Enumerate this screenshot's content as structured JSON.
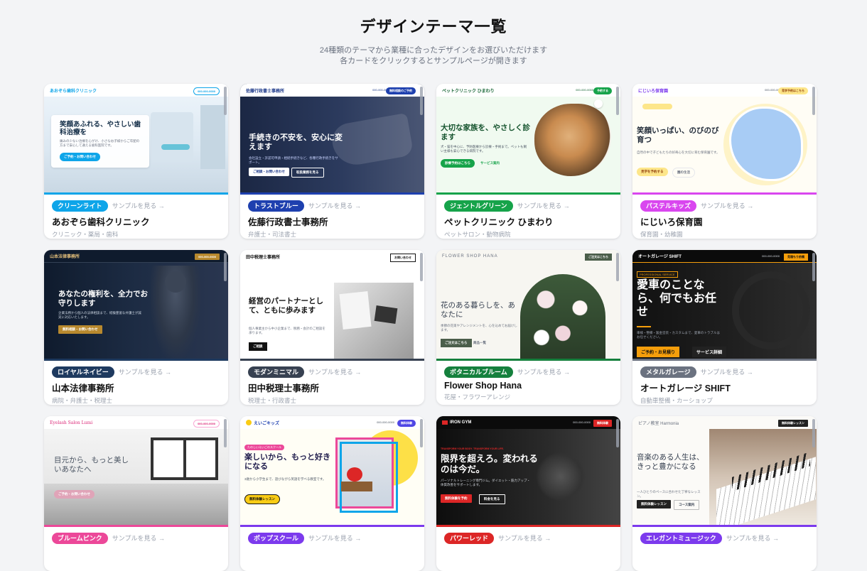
{
  "header": {
    "title": "デザインテーマ一覧",
    "subtitle1": "24種類のテーマから業種に合ったデザインをお選びいただけます",
    "subtitle2": "各カードをクリックするとサンプルページが開きます"
  },
  "sample_link": "サンプルを見る →",
  "cards": [
    {
      "badge": "クリーンライト",
      "color": "#0ea5e9",
      "name": "あおぞら歯科クリニック",
      "category": "クリニック・薬局・歯科",
      "nav": "あおぞら歯科クリニック",
      "nav_btn": "000-000-0000",
      "hero": "笑顔あふれる、やさしい歯科治療を",
      "desc": "痛みの少ない治療を心がけ、小さなお子様からご年配の方まで安心して通える歯科医院です。",
      "cta": "ご予約・お問い合わせ"
    },
    {
      "badge": "トラストブルー",
      "color": "#1e40af",
      "name": "佐藤行政書士事務所",
      "category": "弁護士・司法書士",
      "nav": "佐藤行政書士事務所",
      "nav_btn": "無料相談のご予約",
      "nav_tel": "000-000-0000",
      "hero": "手続きの不安を、安心に変えます",
      "desc": "会社設立・許認可申請・相続手続きなど、各種行政手続きをサポート。",
      "cta": "ご相談・お問い合わせ",
      "cta2": "取扱業務を見る"
    },
    {
      "badge": "ジェントルグリーン",
      "color": "#16a34a",
      "name": "ペットクリニック ひまわり",
      "category": "ペットサロン・動物病院",
      "nav": "ペットクリニック ひまわり",
      "nav_btn": "予約する",
      "nav_tel": "000-000-0000",
      "hero": "大切な家族を、やさしく診ます",
      "desc": "犬・猫を中心に、予防医療から診療・手術まで。ペットも飼い主様も安心できる病院です。",
      "cta": "診療予約はこちら",
      "cta2": "サービス案内"
    },
    {
      "badge": "パステルキッズ",
      "color": "#d946ef",
      "name": "にじいろ保育園",
      "category": "保育園・幼稚園",
      "nav": "にじいろ保育園",
      "nav_btn": "見学予約はこちら",
      "nav_tel": "000-000-0000",
      "hero": "笑顔いっぱい、のびのび育つ",
      "desc": "自然の中で子どもたちの好奇心を大切に育む保育園です。",
      "cta": "見学を予約する",
      "cta2": "園の生活"
    },
    {
      "badge": "ロイヤルネイビー",
      "color": "#1e3a5f",
      "name": "山本法律事務所",
      "category": "病院・弁護士・税理士",
      "nav": "山本法律事務所",
      "nav_btn": "000-000-0000",
      "hero": "あなたの権利を、全力でお守りします",
      "desc": "企業法務から個人の法律相談まで、経験豊富な弁護士が誠実に対応いたします。",
      "cta": "無料相談・お問い合わせ"
    },
    {
      "badge": "モダンミニマル",
      "color": "#374151",
      "name": "田中税理士事務所",
      "category": "税理士・行政書士",
      "nav": "田中税理士事務所",
      "nav_btn": "お問い合わせ",
      "hero": "経営のパートナーとして、ともに歩みます",
      "desc": "個人事業主から中小企業まで、税務・会計のご相談を承ります。",
      "cta": "ご相談"
    },
    {
      "badge": "ボタニカルブルーム",
      "color": "#15803d",
      "name": "Flower Shop Hana",
      "category": "花屋・フラワーアレンジ",
      "nav": "FLOWER SHOP HANA",
      "nav_btn": "ご注文はこちら",
      "hero": "花のある暮らしを、あなたに",
      "desc": "季節の花束やアレンジメントを、心を込めてお届けします。",
      "cta": "ご注文はこちら",
      "cta2": "商品一覧"
    },
    {
      "badge": "メタルガレージ",
      "color": "#6b7280",
      "name": "オートガレージ SHIFT",
      "category": "自動車整備・カーショップ",
      "nav": "オートガレージ SHIFT",
      "nav_btn": "見積もり依頼",
      "nav_tel": "000-000-0000",
      "tag": "PROFESSIONAL SERVICE",
      "hero": "愛車のことなら、何でもお任せ",
      "desc": "車検・整備・鈑金塗装・カスタムまで、愛車のトラブルはお任せください。",
      "cta": "ご予約・お見積り",
      "cta2": "サービス詳細"
    },
    {
      "badge": "ブルームピンク",
      "color": "#ec4899",
      "name": "Eyelash Salon Lumi",
      "category": "",
      "nav": "Eyelash Salon Lumi",
      "nav_btn": "000-000-0000",
      "hero": "目元から、もっと美しいあなたへ",
      "cta": "ご予約・お問い合わせ"
    },
    {
      "badge": "ポップスクール",
      "color": "#7c3aed",
      "name": "えいごキッズ",
      "category": "",
      "nav": "えいごキッズ",
      "nav_btn": "無料体験",
      "nav_tel": "000-000-0000",
      "tag": "たのしいえいごのスクール",
      "hero": "楽しいから、もっと好きになる",
      "desc": "3歳から小学生まで、遊びながら英語を学べる教室です。",
      "cta": "無料体験レッスン"
    },
    {
      "badge": "パワーレッド",
      "color": "#dc2626",
      "name": "IRON GYM",
      "category": "",
      "nav": "IRON GYM",
      "nav_btn": "無料体験",
      "nav_tel": "000-000-0000",
      "tag": "TRANSFORM YOUR BODY. TRANSFORM YOUR LIFE.",
      "hero": "限界を超えろ。変われるのは今だ。",
      "desc": "パーソナルトレーニング専門ジム。ダイエット・筋力アップ・体質改善をサポートします。",
      "cta": "無料体験を予約",
      "cta2": "料金を見る"
    },
    {
      "badge": "エレガントミュージック",
      "color": "#7c3aed",
      "name": "ピアノ教室 Harmonia",
      "category": "",
      "nav": "ピアノ教室 Harmonia",
      "nav_btn": "無料体験レッスン",
      "hero": "音楽のある人生は、きっと豊かになる",
      "desc": "一人ひとりのペースに合わせた丁寧なレッスン。",
      "cta": "無料体験レッスン",
      "cta2": "コース案内"
    }
  ],
  "accent_colors": {
    "page_bg": "#f3f4f6",
    "text_muted": "#9ca3af"
  }
}
